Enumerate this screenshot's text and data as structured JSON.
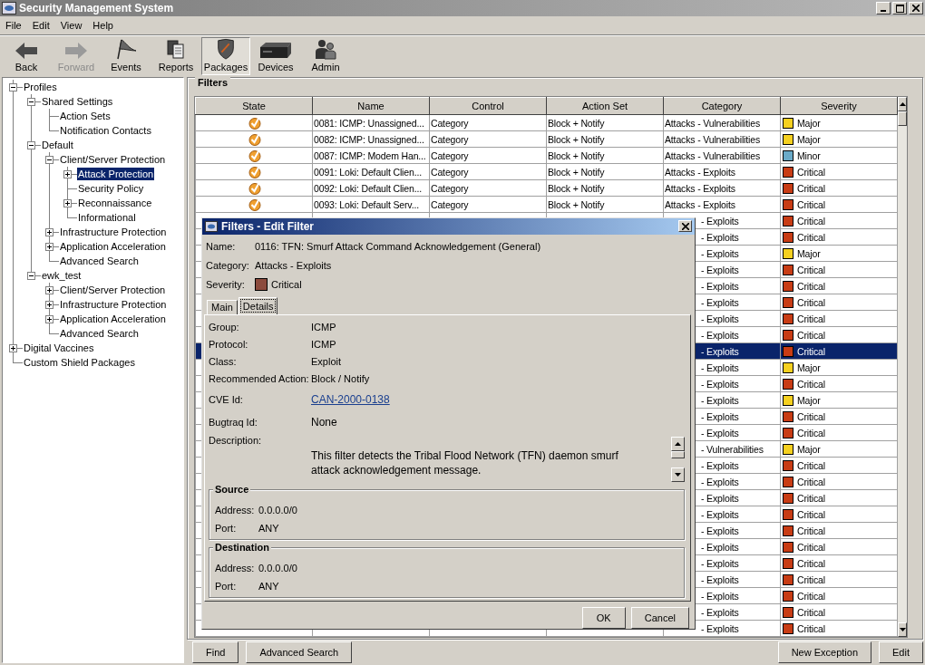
{
  "window": {
    "title": "Security Management System"
  },
  "menu": [
    "File",
    "Edit",
    "View",
    "Help"
  ],
  "toolbar": [
    {
      "label": "Back",
      "kind": "back",
      "disabled": false,
      "selected": false
    },
    {
      "label": "Forward",
      "kind": "forward",
      "disabled": true,
      "selected": false
    },
    {
      "label": "Events",
      "kind": "events",
      "disabled": false,
      "selected": false
    },
    {
      "label": "Reports",
      "kind": "reports",
      "disabled": false,
      "selected": false
    },
    {
      "label": "Packages",
      "kind": "packages",
      "disabled": false,
      "selected": true
    },
    {
      "label": "Devices",
      "kind": "devices",
      "disabled": false,
      "selected": false
    },
    {
      "label": "Admin",
      "kind": "admin",
      "disabled": false,
      "selected": false
    }
  ],
  "tree": [
    {
      "label": "Profiles",
      "expanded": true,
      "selected": false,
      "children": [
        {
          "label": "Shared Settings",
          "expanded": true,
          "selected": false,
          "children": [
            {
              "label": "Action Sets",
              "selected": false
            },
            {
              "label": "Notification Contacts",
              "selected": false
            }
          ]
        },
        {
          "label": "Default",
          "expanded": true,
          "selected": false,
          "children": [
            {
              "label": "Client/Server Protection",
              "expanded": true,
              "selected": false,
              "children": [
                {
                  "label": "Attack Protection",
                  "expanded": false,
                  "selected": true
                },
                {
                  "label": "Security Policy",
                  "selected": false
                },
                {
                  "label": "Reconnaissance",
                  "expanded": false,
                  "selected": false
                },
                {
                  "label": "Informational",
                  "selected": false
                }
              ]
            },
            {
              "label": "Infrastructure Protection",
              "expanded": false,
              "selected": false
            },
            {
              "label": "Application Acceleration",
              "expanded": false,
              "selected": false
            },
            {
              "label": "Advanced Search",
              "selected": false
            }
          ]
        },
        {
          "label": "ewk_test",
          "expanded": true,
          "selected": false,
          "children": [
            {
              "label": "Client/Server Protection",
              "expanded": false,
              "selected": false
            },
            {
              "label": "Infrastructure Protection",
              "expanded": false,
              "selected": false
            },
            {
              "label": "Application Acceleration",
              "expanded": false,
              "selected": false
            },
            {
              "label": "Advanced Search",
              "selected": false
            }
          ]
        }
      ]
    },
    {
      "label": "Digital Vaccines",
      "expanded": false,
      "selected": false
    },
    {
      "label": "Custom Shield Packages",
      "selected": false
    }
  ],
  "filters": {
    "title": "Filters",
    "columns": [
      "State",
      "Name",
      "Control",
      "Action Set",
      "Category",
      "Severity"
    ],
    "rows": [
      {
        "enabled": true,
        "name": "0081: ICMP: Unassigned...",
        "control": "Category",
        "action_set": "Block + Notify",
        "category": "Attacks - Vulnerabilities",
        "severity": "Major",
        "color": "#f5d020",
        "selected": false
      },
      {
        "enabled": true,
        "name": "0082: ICMP: Unassigned...",
        "control": "Category",
        "action_set": "Block + Notify",
        "category": "Attacks - Vulnerabilities",
        "severity": "Major",
        "color": "#f5d020",
        "selected": false
      },
      {
        "enabled": true,
        "name": "0087: ICMP: Modem Han...",
        "control": "Category",
        "action_set": "Block + Notify",
        "category": "Attacks - Vulnerabilities",
        "severity": "Minor",
        "color": "#6aaac8",
        "selected": false
      },
      {
        "enabled": true,
        "name": "0091: Loki: Default Clien...",
        "control": "Category",
        "action_set": "Block + Notify",
        "category": "Attacks - Exploits",
        "severity": "Critical",
        "color": "#c83c14",
        "selected": false
      },
      {
        "enabled": true,
        "name": "0092: Loki: Default Clien...",
        "control": "Category",
        "action_set": "Block + Notify",
        "category": "Attacks - Exploits",
        "severity": "Critical",
        "color": "#c83c14",
        "selected": false
      },
      {
        "enabled": true,
        "name": "0093: Loki: Default Serv...",
        "control": "Category",
        "action_set": "Block + Notify",
        "category": "Attacks - Exploits",
        "severity": "Critical",
        "color": "#c83c14",
        "selected": false
      },
      {
        "category": "- Exploits",
        "severity": "Critical",
        "color": "#c83c14",
        "selected": false
      },
      {
        "category": "- Exploits",
        "severity": "Critical",
        "color": "#c83c14",
        "selected": false
      },
      {
        "category": "- Exploits",
        "severity": "Major",
        "color": "#f5d020",
        "selected": false
      },
      {
        "category": "- Exploits",
        "severity": "Critical",
        "color": "#c83c14",
        "selected": false
      },
      {
        "category": "- Exploits",
        "severity": "Critical",
        "color": "#c83c14",
        "selected": false
      },
      {
        "category": "- Exploits",
        "severity": "Critical",
        "color": "#c83c14",
        "selected": false
      },
      {
        "category": "- Exploits",
        "severity": "Critical",
        "color": "#c83c14",
        "selected": false
      },
      {
        "category": "- Exploits",
        "severity": "Critical",
        "color": "#c83c14",
        "selected": false
      },
      {
        "category": "- Exploits",
        "severity": "Critical",
        "color": "#c83c14",
        "selected": true
      },
      {
        "category": "- Exploits",
        "severity": "Major",
        "color": "#f5d020",
        "selected": false
      },
      {
        "category": "- Exploits",
        "severity": "Critical",
        "color": "#c83c14",
        "selected": false
      },
      {
        "category": "- Exploits",
        "severity": "Major",
        "color": "#f5d020",
        "selected": false
      },
      {
        "category": "- Exploits",
        "severity": "Critical",
        "color": "#c83c14",
        "selected": false
      },
      {
        "category": "- Exploits",
        "severity": "Critical",
        "color": "#c83c14",
        "selected": false
      },
      {
        "category": "- Vulnerabilities",
        "severity": "Major",
        "color": "#f5d020",
        "selected": false
      },
      {
        "category": "- Exploits",
        "severity": "Critical",
        "color": "#c83c14",
        "selected": false
      },
      {
        "category": "- Exploits",
        "severity": "Critical",
        "color": "#c83c14",
        "selected": false
      },
      {
        "category": "- Exploits",
        "severity": "Critical",
        "color": "#c83c14",
        "selected": false
      },
      {
        "category": "- Exploits",
        "severity": "Critical",
        "color": "#c83c14",
        "selected": false
      },
      {
        "category": "- Exploits",
        "severity": "Critical",
        "color": "#c83c14",
        "selected": false
      },
      {
        "category": "- Exploits",
        "severity": "Critical",
        "color": "#c83c14",
        "selected": false
      },
      {
        "category": "- Exploits",
        "severity": "Critical",
        "color": "#c83c14",
        "selected": false
      },
      {
        "category": "- Exploits",
        "severity": "Critical",
        "color": "#c83c14",
        "selected": false
      },
      {
        "category": "- Exploits",
        "severity": "Critical",
        "color": "#c83c14",
        "selected": false
      },
      {
        "category": "- Exploits",
        "severity": "Critical",
        "color": "#c83c14",
        "selected": false
      },
      {
        "category": "- Exploits",
        "severity": "Critical",
        "color": "#c83c14",
        "selected": false
      }
    ]
  },
  "dialog": {
    "title": "Filters - Edit Filter",
    "summary": [
      {
        "label": "Name:",
        "value": "0116: TFN: Smurf Attack Command Acknowledgement (General)"
      },
      {
        "label": "Category:",
        "value": "Attacks - Exploits"
      }
    ],
    "severity": {
      "label": "Severity:",
      "value": "Critical",
      "color": "#8c4b3d"
    },
    "tabs": [
      {
        "label": "Main",
        "selected": false
      },
      {
        "label": "Details",
        "selected": true
      }
    ],
    "details": [
      {
        "label": "Group:",
        "value": "ICMP",
        "kind": "text"
      },
      {
        "label": "Protocol:",
        "value": "ICMP",
        "kind": "text"
      },
      {
        "label": "Class:",
        "value": "Exploit",
        "kind": "text"
      },
      {
        "label": "Recommended Action:",
        "value": "Block / Notify",
        "kind": "text"
      },
      {
        "label": "CVE Id:",
        "value": "CAN-2000-0138",
        "kind": "link"
      },
      {
        "label": "Bugtraq Id:",
        "value": "None",
        "kind": "large"
      }
    ],
    "description": {
      "label": "Description:",
      "text": "This filter detects the Tribal Flood Network (TFN) daemon smurf attack acknowledgement message."
    },
    "groups": [
      {
        "title": "Source",
        "address_label": "Address:",
        "address": "0.0.0.0/0",
        "port_label": "Port:",
        "port": "ANY"
      },
      {
        "title": "Destination",
        "address_label": "Address:",
        "address": "0.0.0.0/0",
        "port_label": "Port:",
        "port": "ANY"
      }
    ],
    "buttons": [
      "OK",
      "Cancel"
    ]
  },
  "buttons_left": [
    "Find",
    "Advanced Search"
  ],
  "buttons_right": [
    "New Exception",
    "Edit"
  ]
}
